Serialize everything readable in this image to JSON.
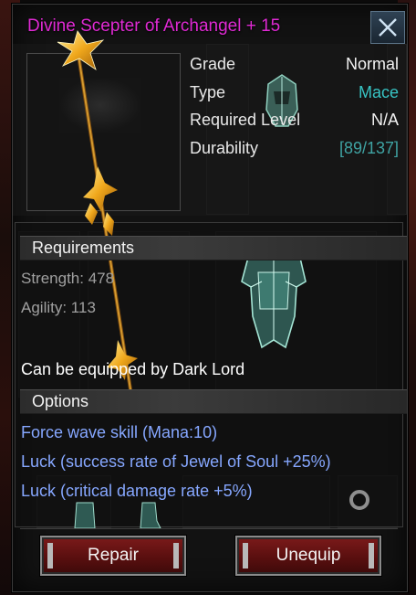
{
  "item": {
    "name": "Divine Scepter of Archangel + 15",
    "name_color": "#e02ad4"
  },
  "attributes": [
    {
      "label": "Grade",
      "value": "Normal",
      "value_color": "#f2f2f2"
    },
    {
      "label": "Type",
      "value": "Mace",
      "value_color": "#37c4c4"
    },
    {
      "label": "Required Level",
      "value": "N/A",
      "value_color": "#f2f2f2"
    },
    {
      "label": "Durability",
      "value": "[89/137]",
      "value_color": "#3fa3a3"
    }
  ],
  "requirements": {
    "header": "Requirements",
    "lines": [
      "Strength: 478",
      "Agility: 113"
    ],
    "equip_note": "Can be equipped by Dark Lord"
  },
  "options": {
    "header": "Options",
    "lines": [
      "Force wave skill (Mana:10)",
      "Luck (success rate of Jewel of Soul +25%)",
      "Luck (critical damage rate +5%)"
    ],
    "color": "#86a7ff"
  },
  "buttons": {
    "repair": "Repair",
    "unequip": "Unequip"
  },
  "icons": {
    "close": "close-icon",
    "item": "scepter-icon",
    "armor": "armor-icon",
    "helm": "helm-icon"
  }
}
